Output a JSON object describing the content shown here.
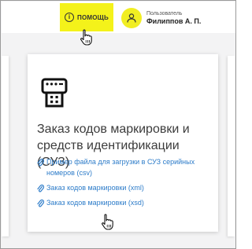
{
  "header": {
    "help": {
      "icon": "info-icon",
      "label": "ПОМОЩЬ"
    },
    "user": {
      "role_label": "Пользователь",
      "name": "Филиппов А. П.",
      "avatar_icon": "user-icon"
    }
  },
  "card": {
    "icon": "printer-icon",
    "title": "Заказ кодов маркировки и средств идентификации (СУЗ)",
    "links": [
      {
        "icon": "paperclip-icon",
        "label": "Пример файла для загрузки в СУЗ серийных номеров (csv)"
      },
      {
        "icon": "paperclip-icon",
        "label": "Заказ кодов маркировки (xml)"
      },
      {
        "icon": "paperclip-icon",
        "label": "Заказ кодов маркировки (xsd)"
      }
    ]
  },
  "colors": {
    "accent_yellow": "#f4f21a",
    "link_blue": "#2d7cc9",
    "background": "#f3f3f4"
  }
}
